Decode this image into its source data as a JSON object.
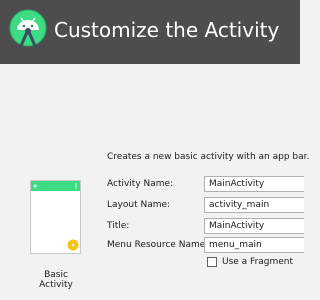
{
  "header": {
    "title": "Customize the Activity",
    "logo_icon": "android-studio-logo-icon",
    "background": "#4d4d4d"
  },
  "description": "Creates a new basic activity with an app bar.",
  "template": {
    "label": "Basic Activity",
    "appbar_color": "#3ddc84",
    "fab_color": "#f9c31a"
  },
  "form": {
    "activity_name": {
      "label": "Activity Name:",
      "value": "MainActivity"
    },
    "layout_name": {
      "label": "Layout Name:",
      "value": "activity_main"
    },
    "title": {
      "label": "Title:",
      "value": "MainActivity"
    },
    "menu_resource_name": {
      "label": "Menu Resource Name:",
      "value": "menu_main"
    }
  },
  "fragment": {
    "label": "Use a Fragment",
    "checked": false
  }
}
